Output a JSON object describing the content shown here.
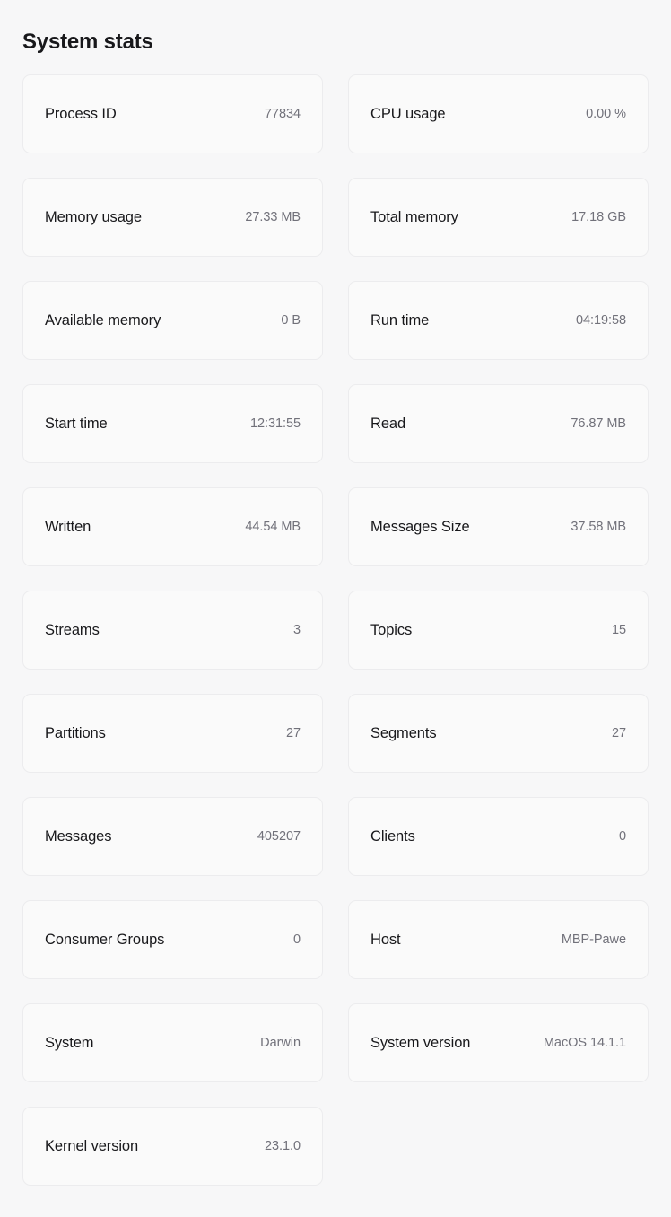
{
  "header": {
    "title": "System stats"
  },
  "theme": {
    "page_background": "#f7f7f8",
    "card_background": "#fafafa",
    "card_border": "#ececee",
    "label_color": "#18181b",
    "value_color": "#71717a"
  },
  "stats": [
    {
      "label": "Process ID",
      "value": "77834"
    },
    {
      "label": "CPU usage",
      "value": "0.00 %"
    },
    {
      "label": "Memory usage",
      "value": "27.33 MB"
    },
    {
      "label": "Total memory",
      "value": "17.18 GB"
    },
    {
      "label": "Available memory",
      "value": "0 B"
    },
    {
      "label": "Run time",
      "value": "04:19:58"
    },
    {
      "label": "Start time",
      "value": "12:31:55"
    },
    {
      "label": "Read",
      "value": "76.87 MB"
    },
    {
      "label": "Written",
      "value": "44.54 MB"
    },
    {
      "label": "Messages Size",
      "value": "37.58 MB"
    },
    {
      "label": "Streams",
      "value": "3"
    },
    {
      "label": "Topics",
      "value": "15"
    },
    {
      "label": "Partitions",
      "value": "27"
    },
    {
      "label": "Segments",
      "value": "27"
    },
    {
      "label": "Messages",
      "value": "405207"
    },
    {
      "label": "Clients",
      "value": "0"
    },
    {
      "label": "Consumer Groups",
      "value": "0"
    },
    {
      "label": "Host",
      "value": "MBP-Pawe"
    },
    {
      "label": "System",
      "value": "Darwin"
    },
    {
      "label": "System version",
      "value": "MacOS 14.1.1"
    },
    {
      "label": "Kernel version",
      "value": "23.1.0"
    }
  ]
}
